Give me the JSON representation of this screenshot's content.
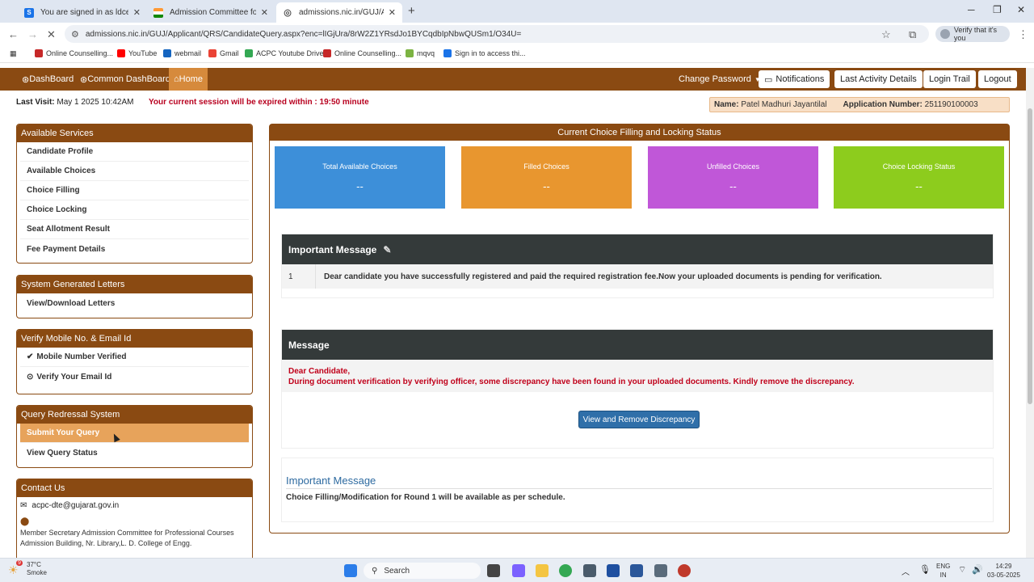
{
  "browser": {
    "tabs": [
      {
        "label": "You are signed in as ldce",
        "icon": "s-icon",
        "color": "#1a73e8",
        "active": false
      },
      {
        "label": "Admission Committee for Profe",
        "icon": "india-flag-icon",
        "color": "#ff9933",
        "active": false
      },
      {
        "label": "admissions.nic.in/GUJ/Applican",
        "icon": "globe-icon",
        "color": "#555555",
        "active": true
      }
    ],
    "url": "admissions.nic.in/GUJ/Applicant/QRS/CandidateQuery.aspx?enc=lIGjUra/8rW2Z1YRsdJo1BYCqdbIpNbwQUSm1/O34U=",
    "verify_label": "Verify that it's you",
    "bookmarks": [
      {
        "label": "Online Counselling...",
        "color": "#c62828"
      },
      {
        "label": "YouTube",
        "color": "#ff0000"
      },
      {
        "label": "webmail",
        "color": "#1565c0"
      },
      {
        "label": "Gmail",
        "color": "#ea4335"
      },
      {
        "label": "ACPC Youtube Drive",
        "color": "#34a853"
      },
      {
        "label": "Online Counselling...",
        "color": "#c62828"
      },
      {
        "label": "mqvq",
        "color": "#7cb342"
      },
      {
        "label": "Sign in to access thi...",
        "color": "#1a73e8"
      }
    ]
  },
  "nav": {
    "dashboard": "DashBoard",
    "common_dashboard": "Common DashBoard",
    "home": "Home",
    "change_password": "Change Password",
    "notifications": "Notifications",
    "last_activity": "Last Activity Details",
    "login_trail": "Login Trail",
    "logout": "Logout"
  },
  "session": {
    "last_visit_label": "Last Visit:",
    "last_visit_value": "May 1 2025 10:42AM",
    "expiry": "Your current session will be expired within : 19:50 minute",
    "name_label": "Name:",
    "name_value": "Patel Madhuri Jayantilal",
    "app_label": "Application Number:",
    "app_value": "251190100003"
  },
  "sidebar": {
    "services": {
      "title": "Available Services",
      "items": [
        "Candidate Profile",
        "Available Choices",
        "Choice Filling",
        "Choice Locking",
        "Seat Allotment Result",
        "Fee Payment Details"
      ]
    },
    "letters": {
      "title": "System Generated Letters",
      "items": [
        "View/Download Letters"
      ]
    },
    "verify": {
      "title": "Verify Mobile No. & Email Id",
      "items": [
        "Mobile Number Verified",
        "Verify Your Email Id"
      ]
    },
    "query": {
      "title": "Query Redressal System",
      "items": [
        "Submit Your Query",
        "View Query Status"
      ]
    },
    "contact": {
      "title": "Contact Us",
      "email": "acpc-dte@gujarat.gov.in",
      "address": "Member Secretary Admission Committee for Professional Courses Admission Building, Nr. Library,L. D. College of Engg."
    }
  },
  "main": {
    "title": "Current Choice Filling and Locking Status",
    "stats": [
      {
        "label": "Total Available Choices",
        "value": "--",
        "color": "#3d8fd9"
      },
      {
        "label": "Filled Choices",
        "value": "--",
        "color": "#e8962f"
      },
      {
        "label": "Unfilled Choices",
        "value": "--",
        "color": "#c057d8"
      },
      {
        "label": "Choice Locking Status",
        "value": "--",
        "color": "#8dcc1d"
      }
    ],
    "important": {
      "title": "Important Message",
      "num": "1",
      "text": "Dear candidate you have successfully registered and paid the required registration fee.Now your uploaded documents is pending for verification."
    },
    "message": {
      "title": "Message",
      "line1": "Dear Candidate,",
      "line2": "During document verification by verifying officer, some discrepancy have been found in your uploaded documents. Kindly remove the discrepancy.",
      "button": "View and Remove Discrepancy"
    },
    "important2": {
      "title": "Important Message",
      "text": "Choice Filling/Modification for Round 1 will be available as per schedule."
    }
  },
  "taskbar": {
    "temp": "37°C",
    "weather": "Smoke",
    "search": "Search",
    "lang1": "ENG",
    "lang2": "IN",
    "time": "14:29",
    "date": "03-05-2025",
    "badge": "9"
  }
}
